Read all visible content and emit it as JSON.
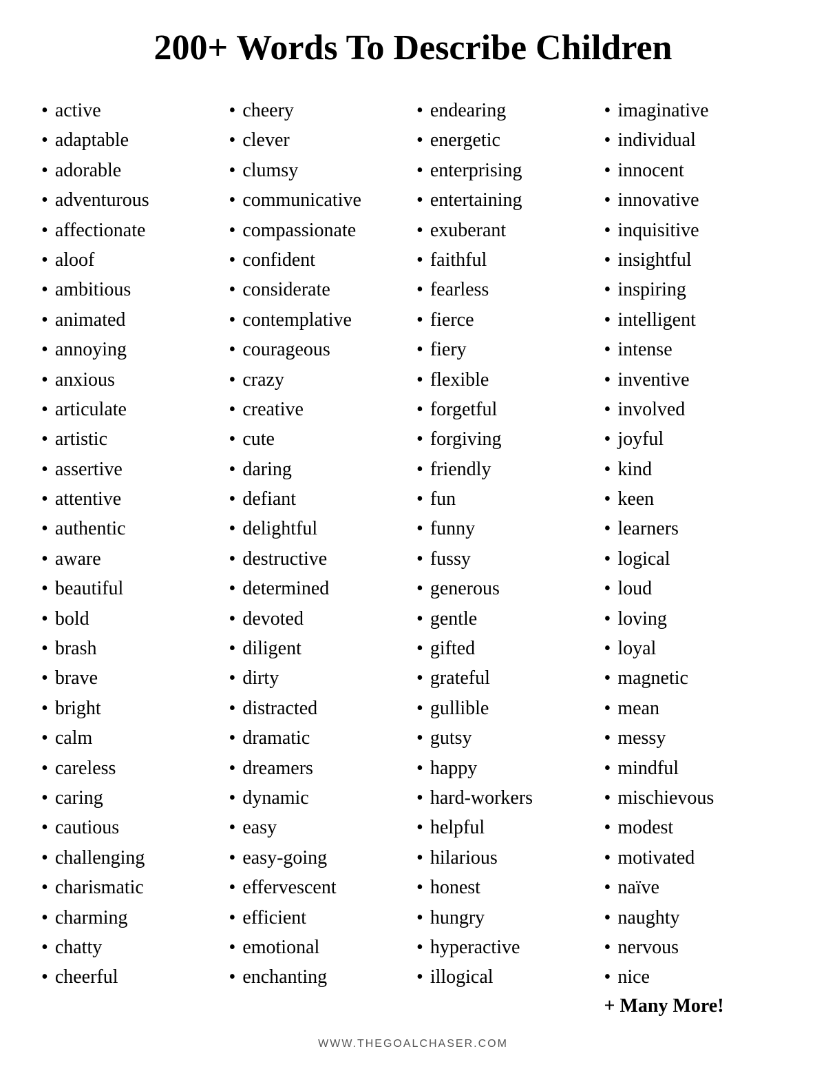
{
  "title": "200+ Words To Describe Children",
  "columns": [
    {
      "id": "col1",
      "words": [
        "active",
        "adaptable",
        "adorable",
        "adventurous",
        "affectionate",
        "aloof",
        "ambitious",
        "animated",
        "annoying",
        "anxious",
        "articulate",
        "artistic",
        "assertive",
        "attentive",
        "authentic",
        "aware",
        "beautiful",
        "bold",
        "brash",
        "brave",
        "bright",
        "calm",
        "careless",
        "caring",
        "cautious",
        "challenging",
        "charismatic",
        "charming",
        "chatty",
        "cheerful"
      ]
    },
    {
      "id": "col2",
      "words": [
        "cheery",
        "clever",
        "clumsy",
        "communicative",
        "compassionate",
        "confident",
        "considerate",
        "contemplative",
        "courageous",
        "crazy",
        "creative",
        "cute",
        "daring",
        "defiant",
        "delightful",
        "destructive",
        "determined",
        "devoted",
        "diligent",
        "dirty",
        "distracted",
        "dramatic",
        "dreamers",
        "dynamic",
        "easy",
        "easy-going",
        "effervescent",
        "efficient",
        "emotional",
        "enchanting"
      ]
    },
    {
      "id": "col3",
      "words": [
        "endearing",
        "energetic",
        "enterprising",
        "entertaining",
        "exuberant",
        "faithful",
        "fearless",
        "fierce",
        "fiery",
        "flexible",
        "forgetful",
        "forgiving",
        "friendly",
        "fun",
        "funny",
        "fussy",
        "generous",
        "gentle",
        "gifted",
        "grateful",
        "gullible",
        "gutsy",
        "happy",
        "hard-workers",
        "helpful",
        "hilarious",
        "honest",
        "hungry",
        "hyperactive",
        "illogical"
      ]
    },
    {
      "id": "col4",
      "words": [
        "imaginative",
        "individual",
        "innocent",
        "innovative",
        "inquisitive",
        "insightful",
        "inspiring",
        "intelligent",
        "intense",
        "inventive",
        "involved",
        "joyful",
        "kind",
        "keen",
        "learners",
        "logical",
        "loud",
        "loving",
        "loyal",
        "magnetic",
        "mean",
        "messy",
        "mindful",
        "mischievous",
        "modest",
        "motivated",
        "naïve",
        "naughty",
        "nervous",
        "nice"
      ]
    }
  ],
  "more_text": "+ Many More!",
  "footer": "WWW.THEGOALCHASER.COM"
}
